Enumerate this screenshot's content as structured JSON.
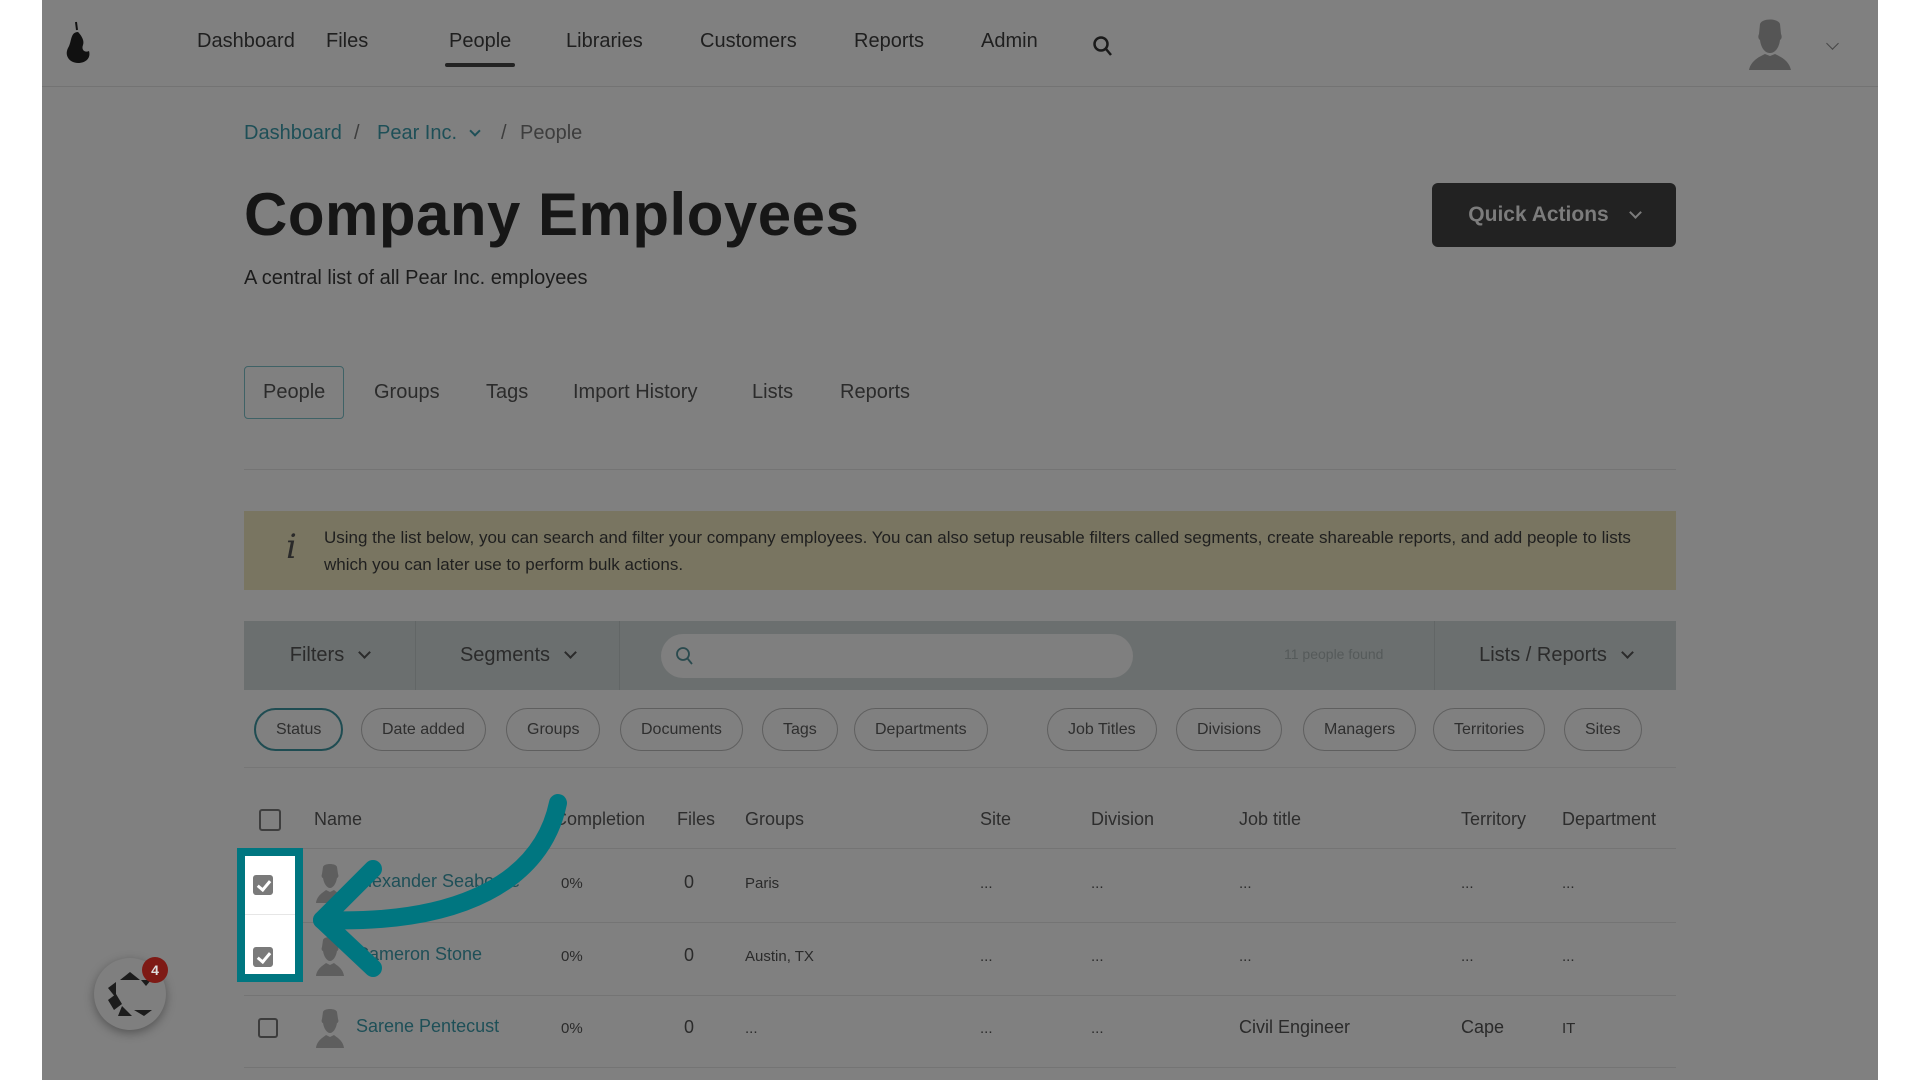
{
  "nav": {
    "logo": "pear-logo",
    "items": [
      "Dashboard",
      "Files",
      "People",
      "Libraries",
      "Customers",
      "Reports",
      "Admin"
    ],
    "active": "People",
    "search_icon": "search-icon",
    "avatar_icon": "user-avatar-icon",
    "user_menu_icon": "chevron-down-icon"
  },
  "breadcrumb": {
    "items": [
      "Dashboard",
      "Pear Inc.",
      "People"
    ],
    "separator": "/"
  },
  "header": {
    "title": "Company Employees",
    "subtitle": "A central list of all Pear Inc. employees",
    "quick_actions": "Quick Actions"
  },
  "tabs": [
    "People",
    "Groups",
    "Tags",
    "Import History",
    "Lists",
    "Reports"
  ],
  "active_tab": "People",
  "info": {
    "icon": "info-icon",
    "text": "Using the list below, you can search and filter your company employees. You can also setup reusable filters called segments, create shareable reports, and add people to lists which you can later use to perform bulk actions."
  },
  "toolbar": {
    "filters": "Filters",
    "segments": "Segments",
    "search_value": "",
    "search_placeholder": "",
    "count": "11 people found",
    "lists_reports": "Lists / Reports"
  },
  "filter_pills": [
    "Status",
    "Date added",
    "Groups",
    "Documents",
    "Tags",
    "Departments",
    "Job Titles",
    "Divisions",
    "Managers",
    "Territories",
    "Sites"
  ],
  "active_pill": "Status",
  "table": {
    "columns": [
      "Name",
      "Completion",
      "Files",
      "Groups",
      "Site",
      "Division",
      "Job title",
      "Territory",
      "Department"
    ],
    "rows": [
      {
        "checked": true,
        "name": "Alexander Seaborne",
        "completion": "0%",
        "files": "0",
        "groups": "Paris",
        "site": "...",
        "division": "...",
        "job_title": "...",
        "territory": "...",
        "department": "..."
      },
      {
        "checked": true,
        "name": "Cameron Stone",
        "completion": "0%",
        "files": "0",
        "groups": "Austin, TX",
        "site": "...",
        "division": "...",
        "job_title": "...",
        "territory": "...",
        "department": "..."
      },
      {
        "checked": false,
        "name": "Sarene Pentecust",
        "completion": "0%",
        "files": "0",
        "groups": "...",
        "site": "...",
        "division": "...",
        "job_title": "Civil Engineer",
        "territory": "Cape",
        "department": "IT"
      }
    ]
  },
  "annotation": {
    "highlight_color": "#007680",
    "target": "row checkboxes"
  },
  "widget": {
    "badge_count": "4",
    "badge_color": "#7e1a15"
  }
}
